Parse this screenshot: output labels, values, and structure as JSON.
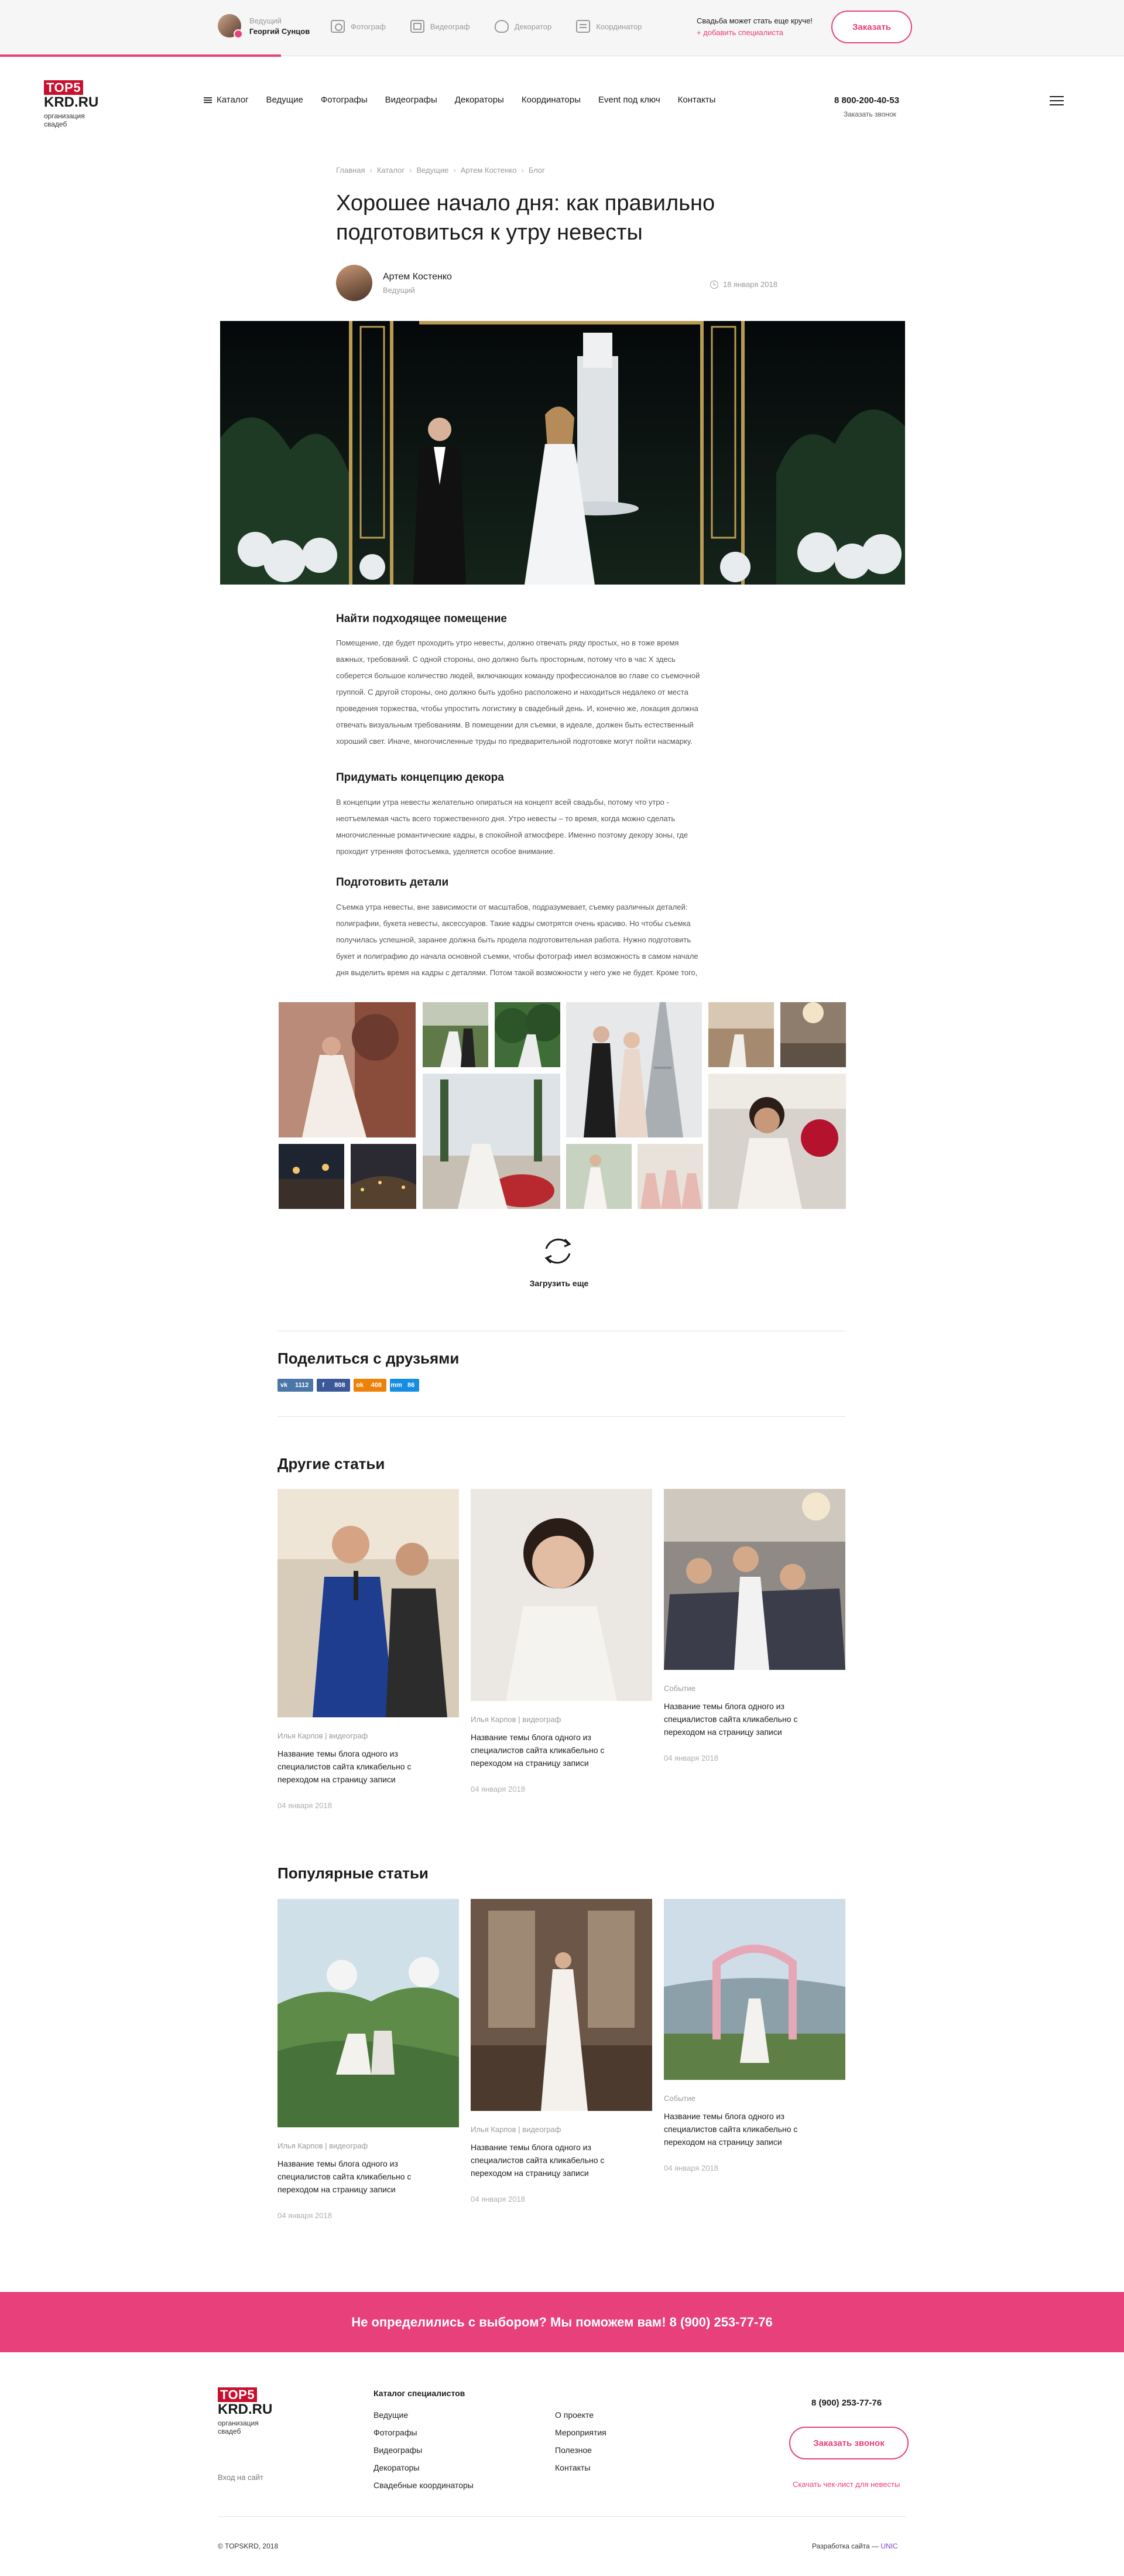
{
  "topbar": {
    "user_role": "Ведущий",
    "user_name": "Георгий Сунцов",
    "links": [
      "Фотограф",
      "Видеограф",
      "Декоратор",
      "Координатор"
    ],
    "promo_line1": "Свадьба может стать еще круче!",
    "promo_line2": "+ добавить специалиста",
    "order_label": "Заказать"
  },
  "brand": {
    "logo_top": "TOP5",
    "logo_mid": "KRD.RU",
    "logo_sub1": "организация",
    "logo_sub2": "свадеб",
    "accent": "#e8407b",
    "logo_red": "#c8102e"
  },
  "nav": {
    "items": [
      "Каталог",
      "Ведущие",
      "Фотографы",
      "Видеографы",
      "Декораторы",
      "Координаторы",
      "Event под ключ",
      "Контакты"
    ],
    "phone": "8 800-200-40-53",
    "callback": "Заказать звонок"
  },
  "article": {
    "breadcrumbs": [
      "Главная",
      "Каталог",
      "Ведущие",
      "Артем Костенко",
      "Блог"
    ],
    "title": "Хорошее начало дня: как правильно подготовиться к утру невесты",
    "author_name": "Артем Костенко",
    "author_role": "Ведущий",
    "date": "18 января 2018",
    "sections": [
      {
        "heading": "Найти подходящее помещение",
        "lines": [
          "Помещение, где будет проходить утро невесты, должно отвечать ряду простых, но в тоже время",
          "важных, требований. С одной стороны, оно должно быть просторным, потому что в час Х здесь",
          "соберется большое количество людей, включающих команду профессионалов во главе со съемочной",
          "группой. С другой стороны, оно должно быть удобно расположено и находиться недалеко от места",
          "проведения торжества, чтобы упростить логистику в свадебный день. И, конечно же, локация должна",
          "отвечать визуальным требованиям. В помещении для съемки, в идеале, должен быть естественный",
          "хороший свет. Иначе, многочисленные труды по предварительной подготовке могут пойти насмарку."
        ]
      },
      {
        "heading": "Придумать концепцию декора",
        "lines": [
          "В концепции утра невесты желательно опираться на концепт всей свадьбы, потому что утро -",
          "неотъемлемая часть всего торжественного дня. Утро невесты – то время, когда можно сделать",
          "многочисленные романтические кадры, в спокойной атмосфере. Именно поэтому декору зоны, где",
          "проходит утренняя фотосъемка, уделяется особое внимание."
        ]
      },
      {
        "heading": "Подготовить детали",
        "lines": [
          "Съемка утра невесты, вне зависимости от масштабов, подразумевает, съемку различных деталей:",
          "полиграфии, букета невесты, аксессуаров. Такие кадры смотрятся очень красиво. Но чтобы съемка",
          "получилась успешной, заранее должна быть продела подготовительная работа. Нужно подготовить",
          "букет и полиграфию до начала основной съемки, чтобы фотограф имел возможность в самом начале",
          "дня выделить время на кадры с деталями. Потом такой возможности у него уже не будет. Кроме того,"
        ]
      }
    ],
    "load_more": "Загрузить еще"
  },
  "share": {
    "title": "Поделиться с друзьями",
    "buttons": [
      {
        "icon": "vk",
        "count": "1112"
      },
      {
        "icon": "f",
        "count": "808"
      },
      {
        "icon": "ok",
        "count": "408"
      },
      {
        "icon": "mm",
        "count": "86"
      }
    ]
  },
  "other_articles": {
    "title": "Другие статьи",
    "cards": [
      {
        "meta": "Илья Карпов | видеограф",
        "title": "Название темы блога одного из специалистов сайта кликабельно с переходом на страницу записи",
        "date": "04 января 2018"
      },
      {
        "meta": "Илья Карпов | видеограф",
        "title": "Название темы блога одного из специалистов сайта кликабельно с переходом на страницу записи",
        "date": "04 января 2018"
      },
      {
        "meta": "Событие",
        "title": "Название темы блога одного из специалистов сайта кликабельно с переходом на страницу записи",
        "date": "04 января 2018"
      }
    ]
  },
  "popular_articles": {
    "title": "Популярные статьи",
    "cards": [
      {
        "meta": "Илья Карпов | видеограф",
        "title": "Название темы блога одного из специалистов сайта кликабельно с переходом на страницу записи",
        "date": "04 января 2018"
      },
      {
        "meta": "Илья Карпов | видеограф",
        "title": "Название темы блога одного из специалистов сайта кликабельно с переходом на страницу записи",
        "date": "04 января 2018"
      },
      {
        "meta": "Событие",
        "title": "Название темы блога одного из специалистов сайта кликабельно с переходом на страницу записи",
        "date": "04 января 2018"
      }
    ]
  },
  "cta": {
    "text": "Не определились с выбором? Мы поможем вам! 8 (900) 253-77-76"
  },
  "footer": {
    "login": "Вход на сайт",
    "catalog_title": "Каталог специалистов",
    "catalog_items": [
      "Ведущие",
      "Фотографы",
      "Видеографы",
      "Декораторы",
      "Свадебные координаторы"
    ],
    "links": [
      "О проекте",
      "Мероприятия",
      "Полезное",
      "Контакты"
    ],
    "phone": "8 (900) 253-77-76",
    "callback": "Заказать звонок",
    "checklist": "Скачать чек-лист для невесты",
    "copyright": "© TOPSKRD, 2018",
    "developer_prefix": "Разработка сайта —",
    "developer": "UNIC"
  }
}
